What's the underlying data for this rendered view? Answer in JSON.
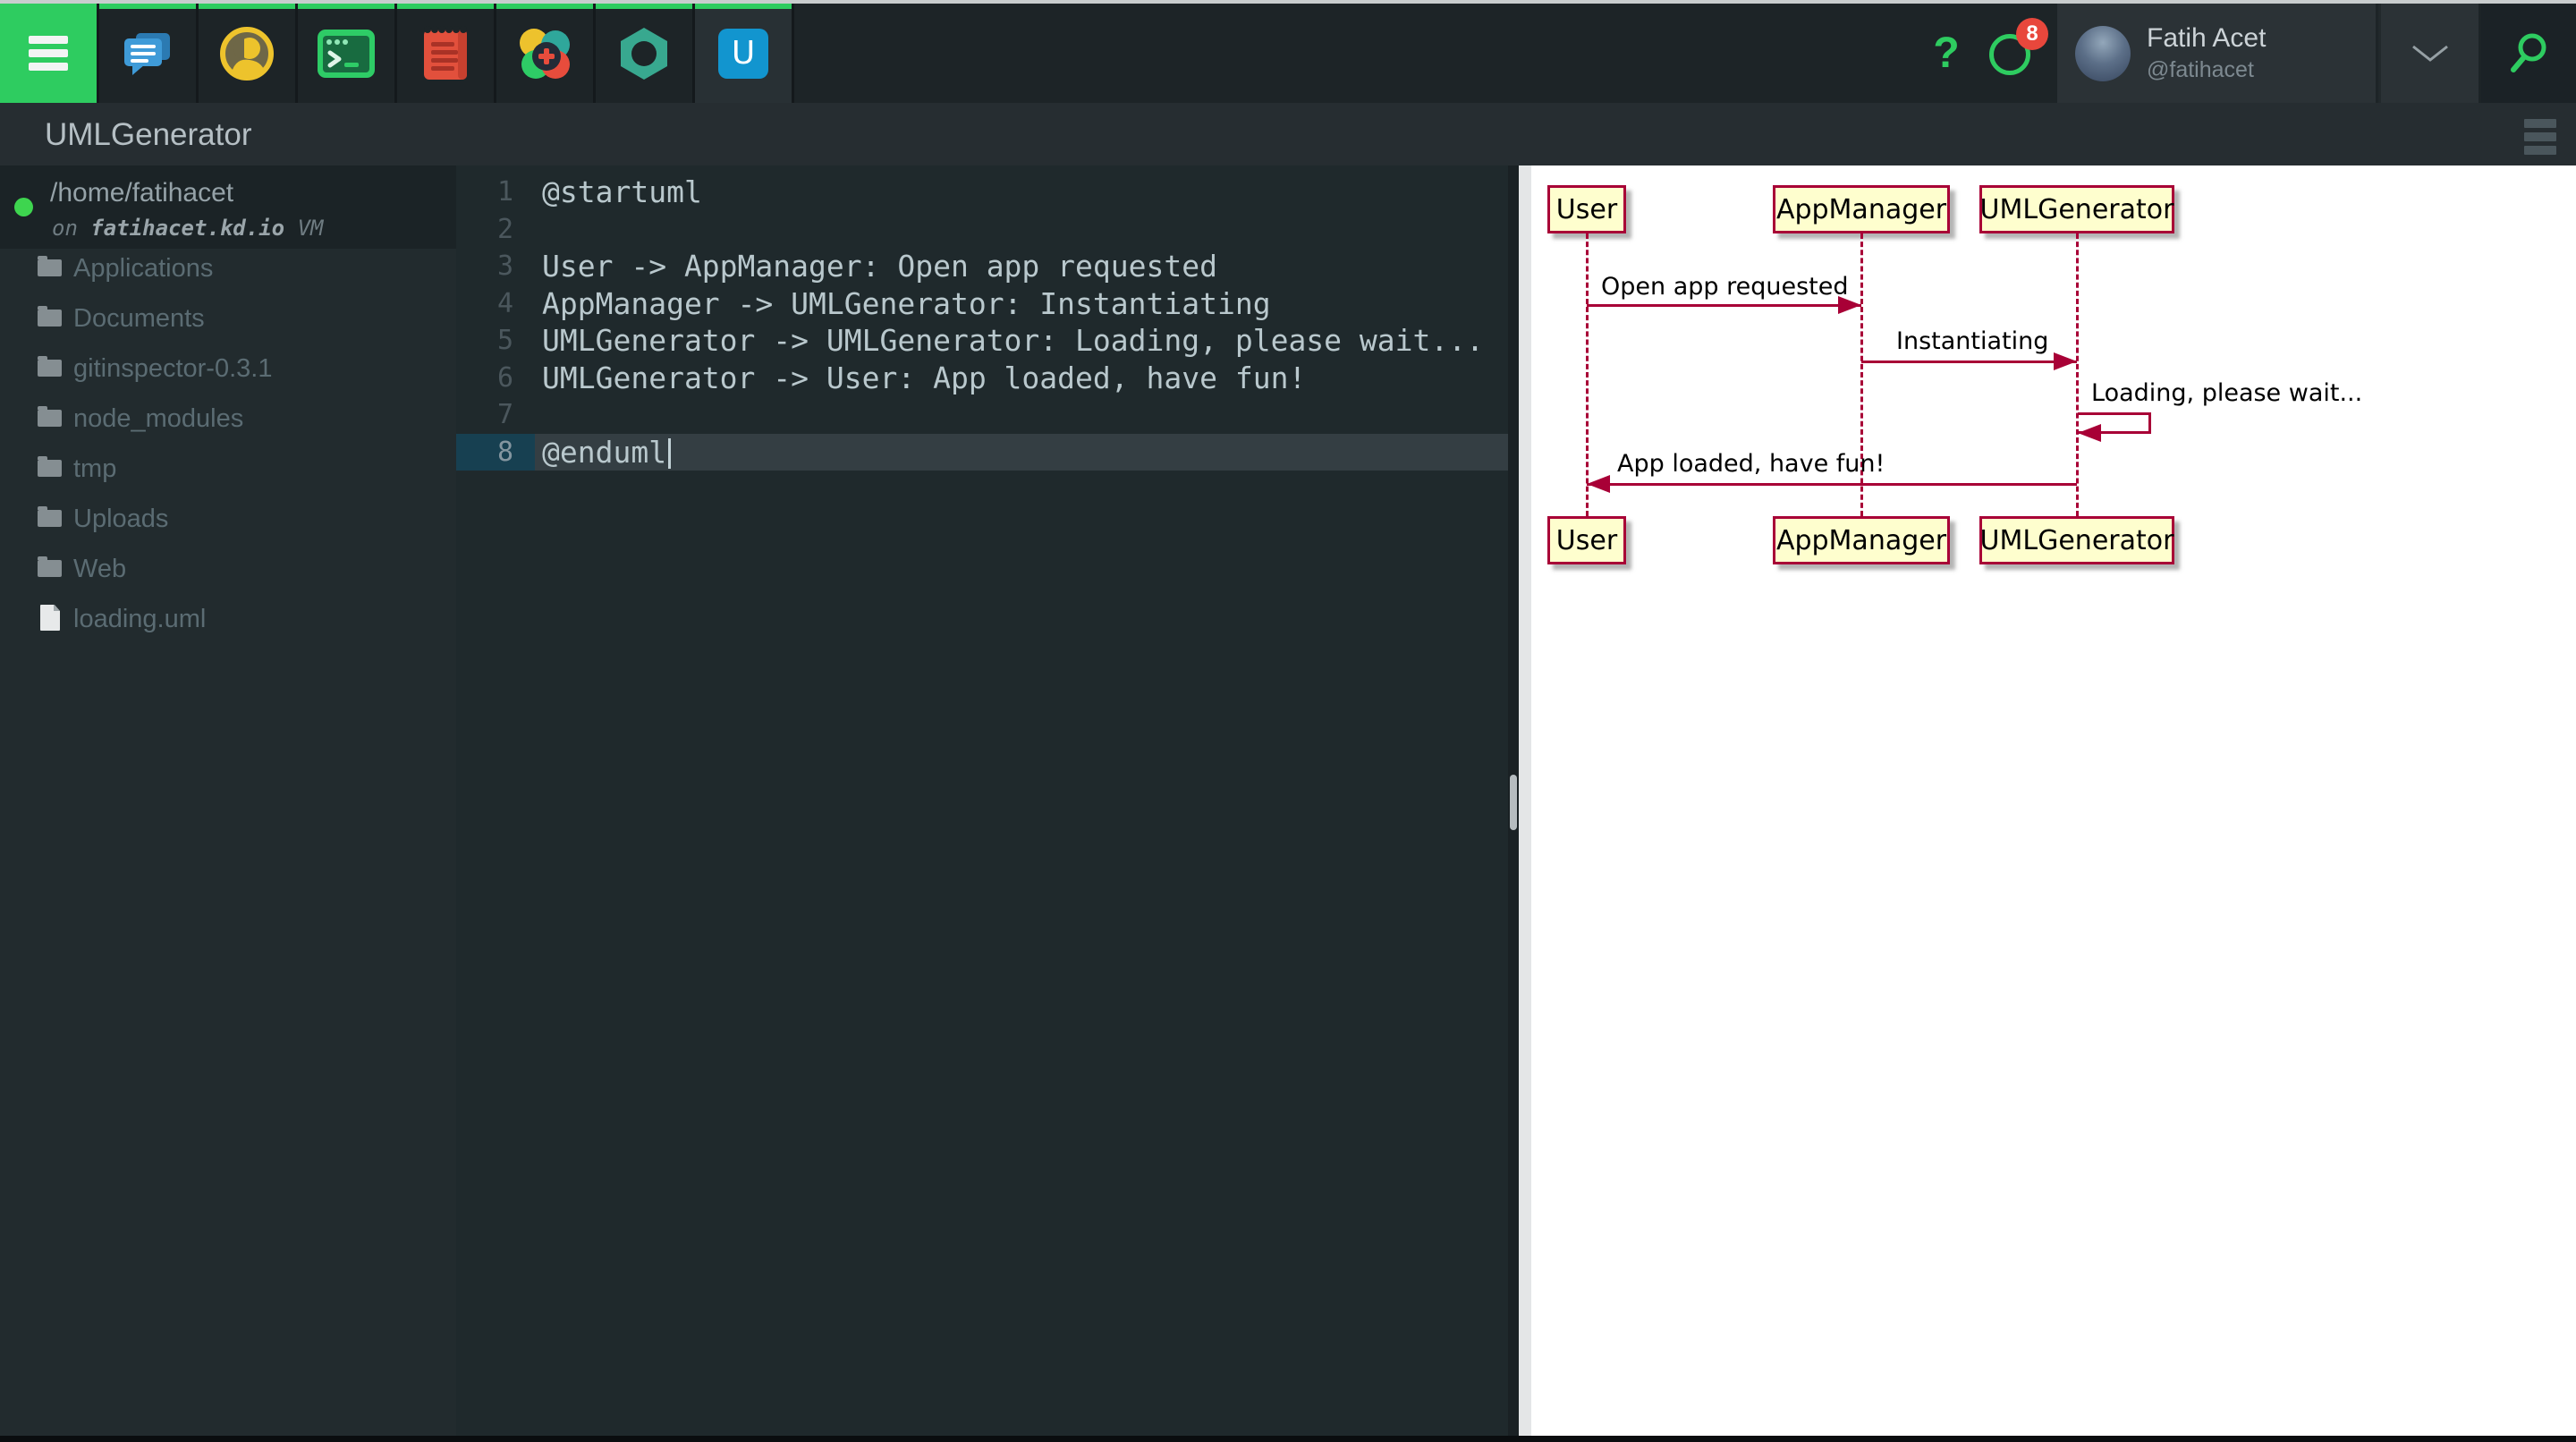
{
  "topbar": {
    "app_icons": [
      "hamburger-icon",
      "chat-icon",
      "members-icon",
      "terminal-icon",
      "notes-icon",
      "app-installer-icon",
      "package-hexagon-icon",
      "umlgenerator-app-icon"
    ],
    "right_icons": [
      "help-icon",
      "activity-ring-icon",
      "search-icon",
      "chevron-down-icon"
    ],
    "uml_app_letter": "U",
    "notification_count": "8",
    "user": {
      "name": "Fatih Acet",
      "handle": "@fatihacet"
    },
    "colors": {
      "accent_green": "#2ecc60",
      "badge_red": "#e8473c",
      "uml_app_blue": "#1295cf"
    }
  },
  "titlebar": {
    "title": "UMLGenerator"
  },
  "sidebar": {
    "machine": {
      "path": "/home/fatihacet",
      "on_word": "on",
      "host": "fatihacet.kd.io",
      "vm_word": "VM",
      "status_color": "#3ed54f"
    },
    "items": [
      {
        "label": "Applications",
        "type": "folder"
      },
      {
        "label": "Documents",
        "type": "folder"
      },
      {
        "label": "gitinspector-0.3.1",
        "type": "folder"
      },
      {
        "label": "node_modules",
        "type": "folder"
      },
      {
        "label": "tmp",
        "type": "folder"
      },
      {
        "label": "Uploads",
        "type": "folder"
      },
      {
        "label": "Web",
        "type": "folder"
      },
      {
        "label": "loading.uml",
        "type": "file"
      }
    ]
  },
  "editor": {
    "active_line": 8,
    "lines": [
      {
        "num": "1",
        "text": "@startuml"
      },
      {
        "num": "2",
        "text": ""
      },
      {
        "num": "3",
        "text": "User -> AppManager: Open app requested"
      },
      {
        "num": "4",
        "text": "AppManager -> UMLGenerator: Instantiating"
      },
      {
        "num": "5",
        "text": "UMLGenerator -> UMLGenerator: Loading, please wait..."
      },
      {
        "num": "6",
        "text": "UMLGenerator -> User: App loaded, have fun!"
      },
      {
        "num": "7",
        "text": ""
      },
      {
        "num": "8",
        "text": "@enduml"
      }
    ]
  },
  "diagram": {
    "participants": [
      "User",
      "AppManager",
      "UMLGenerator"
    ],
    "messages": [
      {
        "from": "User",
        "to": "AppManager",
        "label": "Open app requested"
      },
      {
        "from": "AppManager",
        "to": "UMLGenerator",
        "label": "Instantiating"
      },
      {
        "from": "UMLGenerator",
        "to": "UMLGenerator",
        "label": "Loading, please wait..."
      },
      {
        "from": "UMLGenerator",
        "to": "User",
        "label": "App loaded, have fun!"
      }
    ],
    "colors": {
      "stroke": "#a80036",
      "fill": "#fefece",
      "text": "#000000"
    }
  }
}
